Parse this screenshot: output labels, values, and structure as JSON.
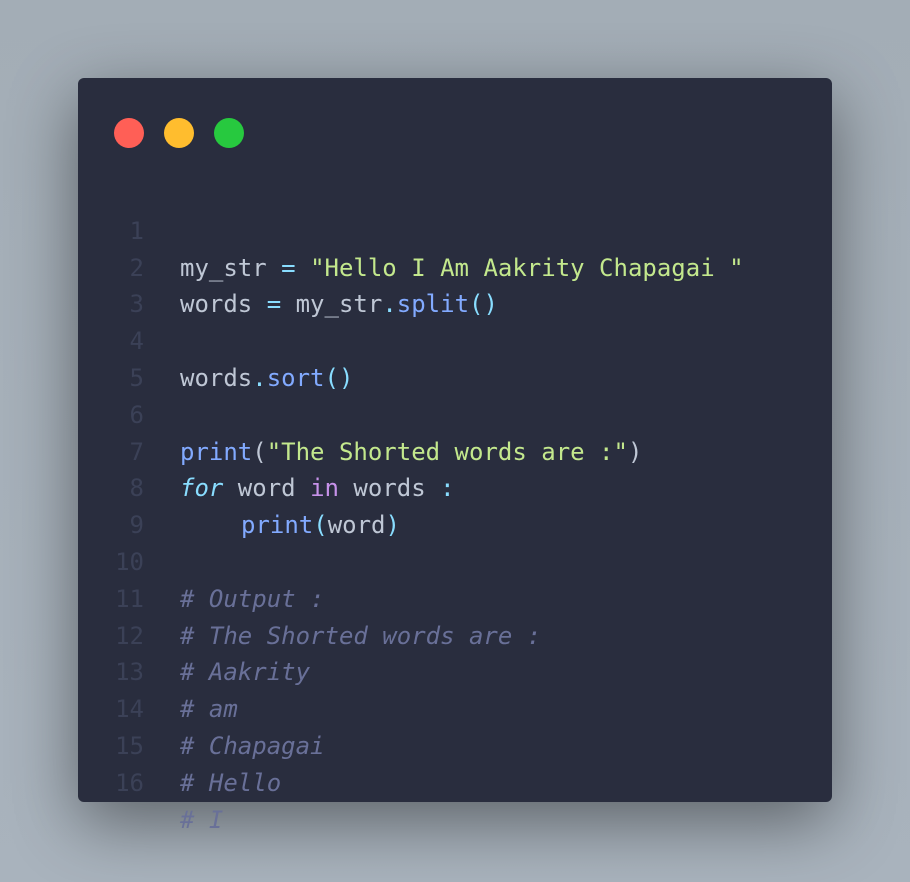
{
  "window": {
    "controls": [
      "close",
      "minimize",
      "maximize"
    ],
    "colors": {
      "background": "#292d3e",
      "close": "#ff5f56",
      "minimize": "#ffbd2e",
      "maximize": "#27c93f",
      "string": "#c3e88d",
      "function": "#82aaff",
      "keyword": "#89ddff",
      "in_keyword": "#c792ea",
      "comment": "#697098",
      "line_number": "#3b4157"
    }
  },
  "code": {
    "language": "python",
    "lines": [
      {
        "n": "1",
        "t": [
          "my_str",
          " = ",
          "\"Hello I Am Aakrity Chapagai \""
        ]
      },
      {
        "n": "2",
        "t": [
          "words",
          " = ",
          "my_str",
          ".",
          "split",
          "()"
        ]
      },
      {
        "n": "3",
        "t": []
      },
      {
        "n": "4",
        "t": [
          "words",
          ".",
          "sort",
          "()"
        ]
      },
      {
        "n": "5",
        "t": []
      },
      {
        "n": "6",
        "t": [
          "print",
          "(",
          "\"The Shorted words are :\"",
          ")"
        ]
      },
      {
        "n": "7",
        "t": [
          "for",
          " word ",
          "in",
          " words ",
          ":"
        ]
      },
      {
        "n": "8",
        "t": [
          "print",
          "(",
          "word",
          ")"
        ]
      },
      {
        "n": "9",
        "t": []
      },
      {
        "n": "10",
        "t": [
          "# Output :"
        ]
      },
      {
        "n": "11",
        "t": [
          "# The Shorted words are :"
        ]
      },
      {
        "n": "12",
        "t": [
          "# Aakrity"
        ]
      },
      {
        "n": "13",
        "t": [
          "# am"
        ]
      },
      {
        "n": "14",
        "t": [
          "# Chapagai"
        ]
      },
      {
        "n": "15",
        "t": [
          "# Hello"
        ]
      },
      {
        "n": "16",
        "t": [
          "# I"
        ]
      }
    ]
  }
}
